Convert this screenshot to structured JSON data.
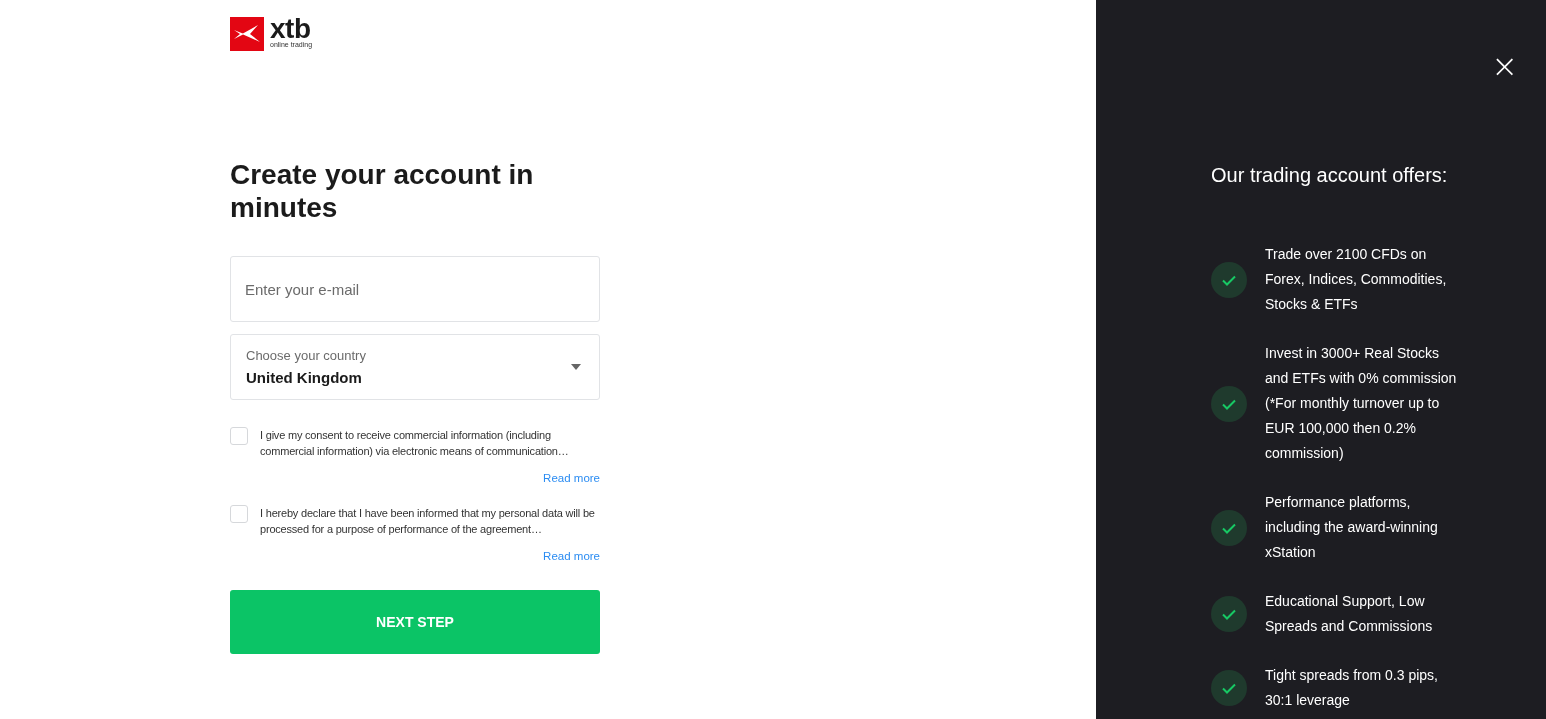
{
  "logo": {
    "name": "xtb",
    "tagline": "online trading"
  },
  "form": {
    "title": "Create your account in minutes",
    "email": {
      "placeholder": "Enter your e-mail"
    },
    "country": {
      "label": "Choose your country",
      "value": "United Kingdom"
    },
    "consents": [
      {
        "text": "I give my consent to receive commercial information (including commercial information) via electronic means of communication…",
        "checked": false,
        "link": "Read more"
      },
      {
        "text": "I hereby declare that I have been informed that my personal data will be processed for a purpose of performance of the agreement…",
        "checked": false,
        "link": "Read more"
      }
    ],
    "submit": "NEXT STEP"
  },
  "panel": {
    "close": "×",
    "title": "Our trading account offers:",
    "offers": [
      "Trade over 2100 CFDs on Forex, Indices, Commodities, Stocks & ETFs",
      "Invest in 3000+ Real Stocks and ETFs with 0% commission (*For monthly turnover up to EUR 100,000 then 0.2% commission)",
      "Performance platforms, including the award-winning xStation",
      "Educational Support, Low Spreads and Commissions",
      "Tight spreads from 0.3 pips, 30:1 leverage"
    ]
  }
}
